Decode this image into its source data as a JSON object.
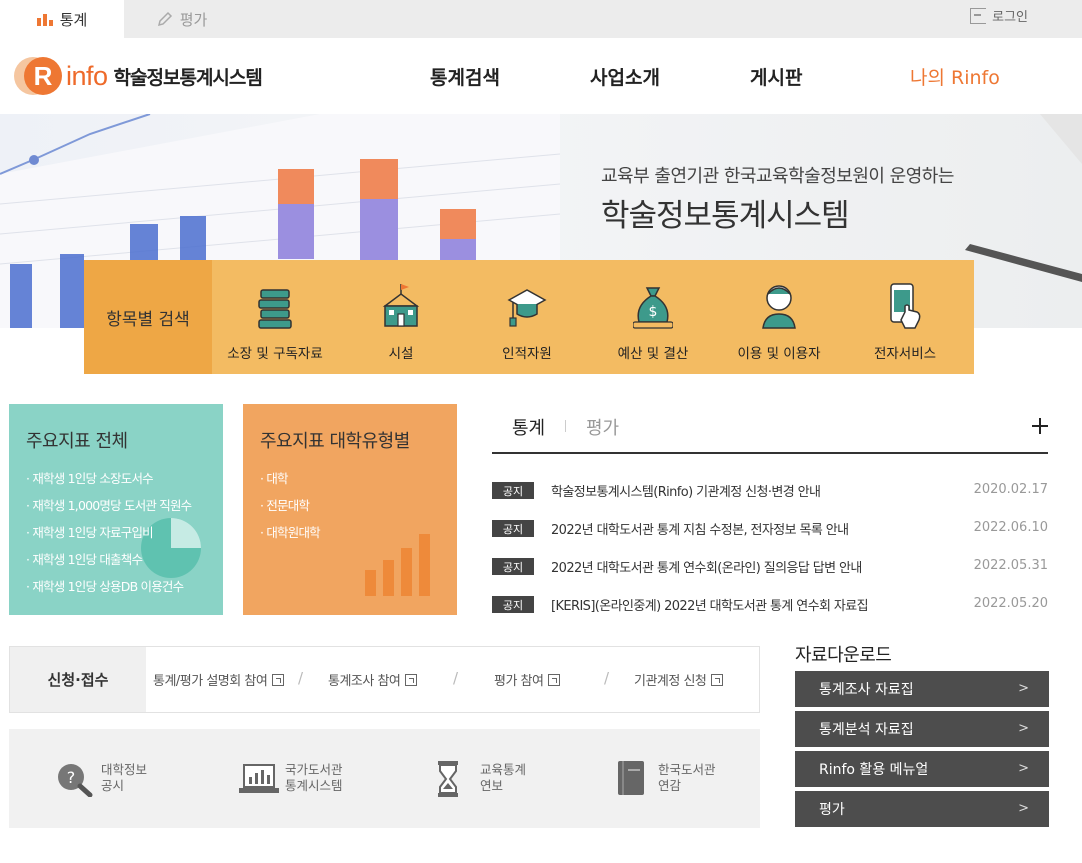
{
  "topbar": {
    "tabs": [
      {
        "label": "통계",
        "active": true,
        "icon": "bar-chart-icon"
      },
      {
        "label": "평가",
        "active": false,
        "icon": "pencil-icon"
      }
    ],
    "login_label": "로그인"
  },
  "header": {
    "logo_text": "info",
    "logo_letter": "R",
    "logo_subtitle": "학술정보통계시스템",
    "nav": [
      "통계검색",
      "사업소개",
      "게시판",
      "나의 Rinfo"
    ]
  },
  "hero": {
    "subtitle": "교육부 출연기관 한국교육학술정보원이 운영하는",
    "title": "학술정보통계시스템"
  },
  "category_search": {
    "label": "항목별 검색",
    "items": [
      {
        "label": "소장 및 구독자료",
        "icon": "books-icon"
      },
      {
        "label": "시설",
        "icon": "building-icon"
      },
      {
        "label": "인적자원",
        "icon": "graduation-cap-icon"
      },
      {
        "label": "예산 및 결산",
        "icon": "money-bag-icon"
      },
      {
        "label": "이용 및 이용자",
        "icon": "person-icon"
      },
      {
        "label": "전자서비스",
        "icon": "touch-device-icon"
      }
    ]
  },
  "indicators": {
    "overall": {
      "title": "주요지표 전체",
      "items": [
        "재학생 1인당 소장도서수",
        "재학생 1,000명당 도서관 직원수",
        "재학생 1인당 자료구입비",
        "재학생 1인당 대출책수",
        "재학생 1인당 상용DB 이용건수"
      ]
    },
    "by_type": {
      "title": "주요지표 대학유형별",
      "items": [
        "대학",
        "전문대학",
        "대학원대학"
      ]
    }
  },
  "board": {
    "tabs": [
      "통계",
      "평가"
    ],
    "notices": [
      {
        "badge": "공지",
        "title": "학술정보통계시스템(Rinfo) 기관계정 신청·변경 안내",
        "date": "2020.02.17"
      },
      {
        "badge": "공지",
        "title": "2022년 대학도서관 통계 지침 수정본, 전자정보 목록 안내",
        "date": "2022.06.10"
      },
      {
        "badge": "공지",
        "title": "2022년 대학도서관 통계 연수회(온라인) 질의응답 답변 안내",
        "date": "2022.05.31"
      },
      {
        "badge": "공지",
        "title": "[KERIS](온라인중계) 2022년 대학도서관 통계 연수회 자료집",
        "date": "2022.05.20"
      }
    ]
  },
  "apply": {
    "label": "신청·접수",
    "links": [
      "통계/평가 설명회 참여",
      "통계조사 참여",
      "평가 참여",
      "기관계정 신청"
    ]
  },
  "quick_links": [
    {
      "line1": "대학정보",
      "line2": "공시",
      "icon": "question-magnifier-icon"
    },
    {
      "line1": "국가도서관",
      "line2": "통계시스템",
      "icon": "laptop-chart-icon"
    },
    {
      "line1": "교육통계",
      "line2": "연보",
      "icon": "hourglass-icon"
    },
    {
      "line1": "한국도서관",
      "line2": "연감",
      "icon": "book-icon"
    }
  ],
  "downloads": {
    "title": "자료다운로드",
    "items": [
      "통계조사 자료집",
      "통계분석 자료집",
      "Rinfo 활용 메뉴얼",
      "평가"
    ]
  },
  "colors": {
    "accent": "#ee7733",
    "teal": "#8ad3c6",
    "orange": "#f1a560",
    "yellow": "#f3bb62",
    "dark": "#4d4d4d"
  }
}
